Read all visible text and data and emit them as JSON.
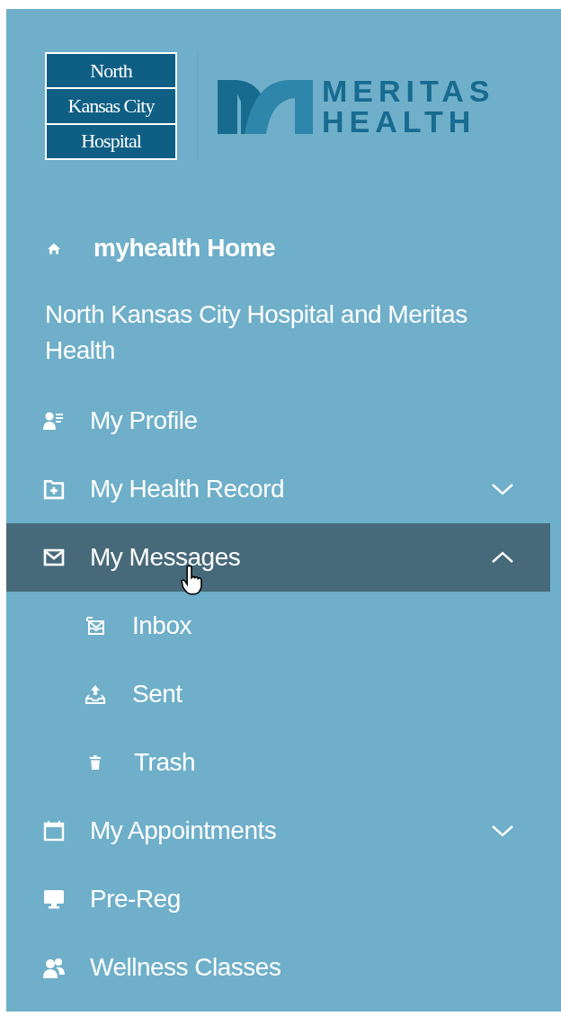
{
  "logos": {
    "hospital": [
      "North",
      "Kansas City",
      "Hospital"
    ],
    "partner": [
      "MERITAS",
      "HEALTH"
    ]
  },
  "nav": [
    {
      "kind": "link",
      "label": "myhealth Home",
      "bold": true,
      "selected": false
    },
    {
      "kind": "text",
      "label": "North Kansas City Hospital and Meritas Health"
    },
    {
      "kind": "link",
      "label": "My Profile",
      "bold": false,
      "selected": false
    },
    {
      "kind": "group",
      "label": "My Health Record",
      "bold": false,
      "selected": false,
      "expanded": false
    },
    {
      "kind": "group",
      "label": "My Messages",
      "bold": false,
      "selected": true,
      "expanded": true,
      "children": [
        {
          "label": "Inbox",
          "selected": false
        },
        {
          "label": "Sent",
          "selected": false
        },
        {
          "label": "Trash",
          "selected": false
        }
      ]
    },
    {
      "kind": "group",
      "label": "My Appointments",
      "bold": false,
      "selected": false,
      "expanded": false
    },
    {
      "kind": "link",
      "label": "Pre-Reg",
      "bold": false,
      "selected": false
    },
    {
      "kind": "link",
      "label": "Wellness Classes",
      "bold": false,
      "selected": false
    }
  ]
}
